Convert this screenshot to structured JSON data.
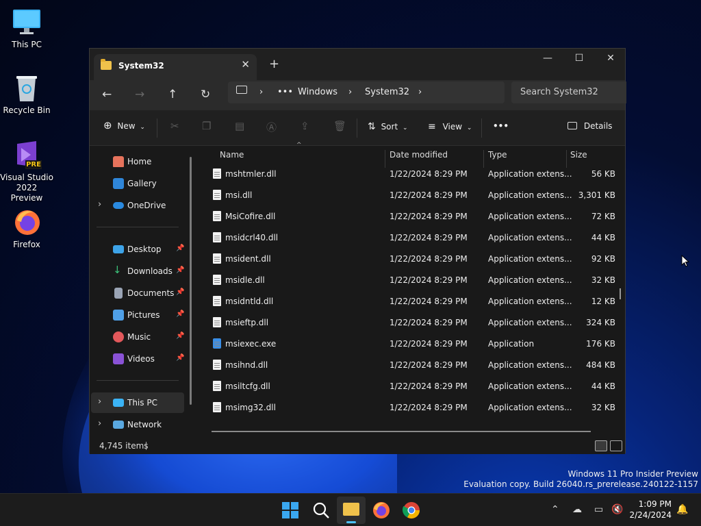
{
  "desktop": {
    "icons": [
      {
        "label": "This PC"
      },
      {
        "label": "Recycle Bin"
      },
      {
        "label": "Visual Studio 2022 Preview",
        "badge": "PRE"
      },
      {
        "label": "Firefox"
      }
    ],
    "watermark": {
      "line1": "Windows 11 Pro Insider Preview",
      "line2": "Evaluation copy. Build 26040.rs_prerelease.240122-1157"
    }
  },
  "window": {
    "tab_title": "System32",
    "breadcrumb": [
      "Windows",
      "System32"
    ],
    "search_placeholder": "Search System32",
    "toolbar": {
      "new_label": "New",
      "sort_label": "Sort",
      "view_label": "View",
      "more_label": "•••",
      "details_label": "Details"
    },
    "sidebar": {
      "home": "Home",
      "gallery": "Gallery",
      "onedrive": "OneDrive",
      "desktop": "Desktop",
      "downloads": "Downloads",
      "documents": "Documents",
      "pictures": "Pictures",
      "music": "Music",
      "videos": "Videos",
      "thispc": "This PC",
      "network": "Network"
    },
    "columns": {
      "name": "Name",
      "date": "Date modified",
      "type": "Type",
      "size": "Size"
    },
    "files": [
      {
        "name": "mshtmler.dll",
        "date": "1/22/2024 8:29 PM",
        "type": "Application extens...",
        "size": "56 KB"
      },
      {
        "name": "msi.dll",
        "date": "1/22/2024 8:29 PM",
        "type": "Application extens...",
        "size": "3,301 KB"
      },
      {
        "name": "MsiCofire.dll",
        "date": "1/22/2024 8:29 PM",
        "type": "Application extens...",
        "size": "72 KB"
      },
      {
        "name": "msidcrl40.dll",
        "date": "1/22/2024 8:29 PM",
        "type": "Application extens...",
        "size": "44 KB"
      },
      {
        "name": "msident.dll",
        "date": "1/22/2024 8:29 PM",
        "type": "Application extens...",
        "size": "92 KB"
      },
      {
        "name": "msidle.dll",
        "date": "1/22/2024 8:29 PM",
        "type": "Application extens...",
        "size": "32 KB"
      },
      {
        "name": "msidntld.dll",
        "date": "1/22/2024 8:29 PM",
        "type": "Application extens...",
        "size": "12 KB"
      },
      {
        "name": "msieftp.dll",
        "date": "1/22/2024 8:29 PM",
        "type": "Application extens...",
        "size": "324 KB"
      },
      {
        "name": "msiexec.exe",
        "date": "1/22/2024 8:29 PM",
        "type": "Application",
        "size": "176 KB"
      },
      {
        "name": "msihnd.dll",
        "date": "1/22/2024 8:29 PM",
        "type": "Application extens...",
        "size": "484 KB"
      },
      {
        "name": "msiltcfg.dll",
        "date": "1/22/2024 8:29 PM",
        "type": "Application extens...",
        "size": "44 KB"
      },
      {
        "name": "msimg32.dll",
        "date": "1/22/2024 8:29 PM",
        "type": "Application extens...",
        "size": "32 KB"
      }
    ],
    "status": {
      "item_count": "4,745 items"
    }
  },
  "taskbar": {
    "time": "1:09 PM",
    "date": "2/24/2024"
  }
}
